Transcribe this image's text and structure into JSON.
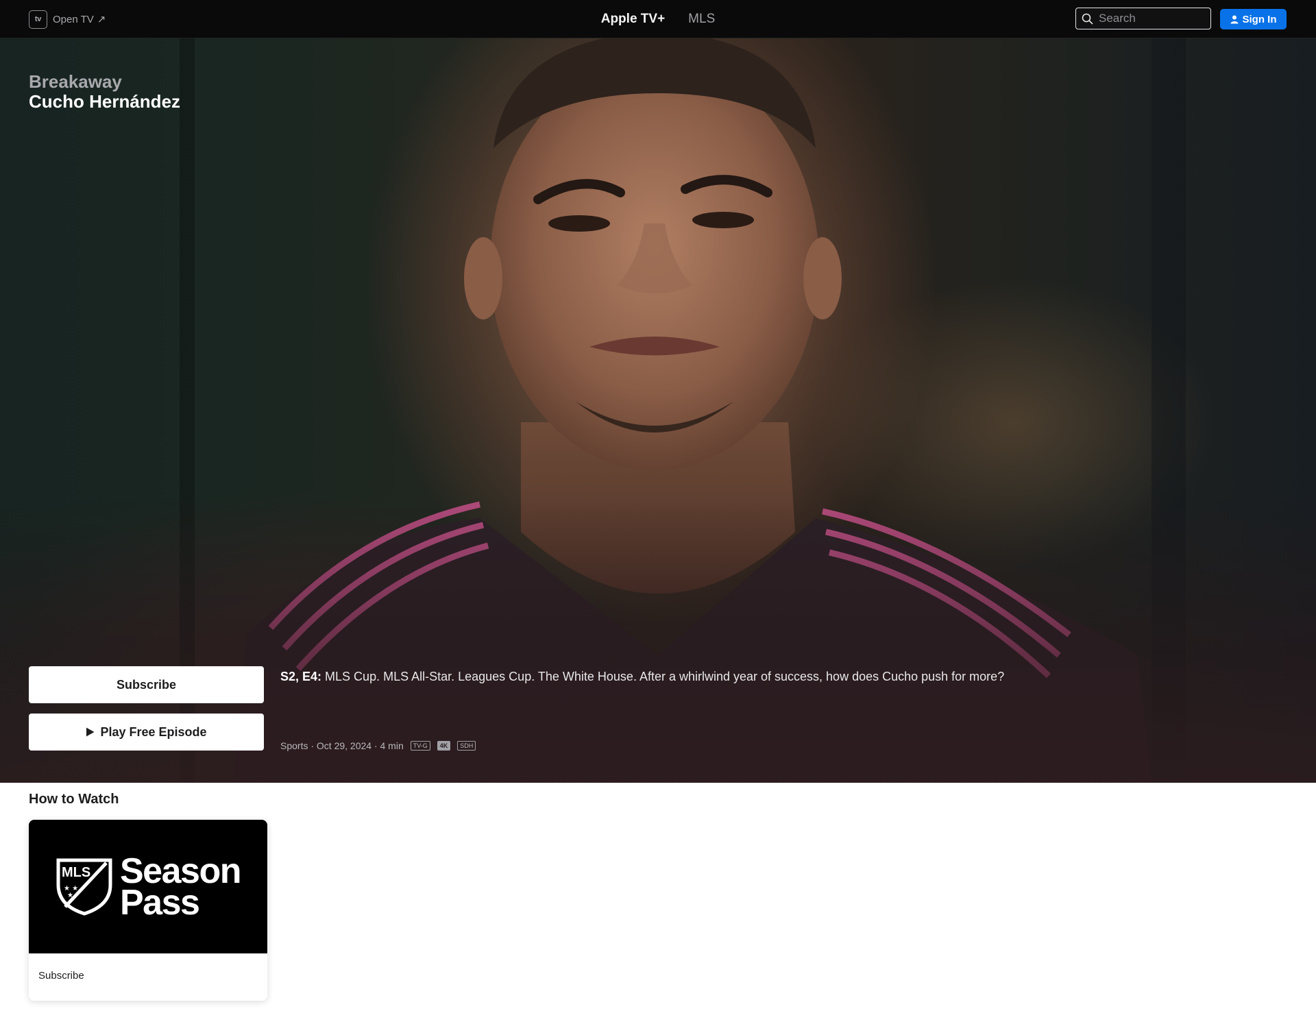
{
  "nav": {
    "open_tv_badge": "tv",
    "open_tv_label": "Open TV",
    "open_tv_arrow": "↗",
    "center_links": [
      "Apple TV+",
      "MLS"
    ],
    "search_placeholder": "Search",
    "signin_label": "Sign In"
  },
  "hero": {
    "show_title": "Breakaway",
    "episode_title": "Cucho Hernández",
    "subscribe_label": "Subscribe",
    "play_label": "Play Free Episode",
    "episode_code": "S2, E4:",
    "description": "MLS Cup. MLS All-Star. Leagues Cup. The White House. After a whirlwind year of success, how does Cucho push for more?",
    "meta_text": "Sports · Oct 29, 2024 · 4 min",
    "badges": [
      "TV-G",
      "4K",
      "SDH"
    ]
  },
  "how_to_watch": {
    "heading": "How to Watch",
    "card": {
      "logo_text": "MLS",
      "title_line1": "Season",
      "title_line2": "Pass",
      "label": "Subscribe"
    }
  },
  "colors": {
    "nav_bg": "#0a0a0a",
    "signin_blue": "#0a72e8",
    "page_bg": "#ffffff"
  }
}
